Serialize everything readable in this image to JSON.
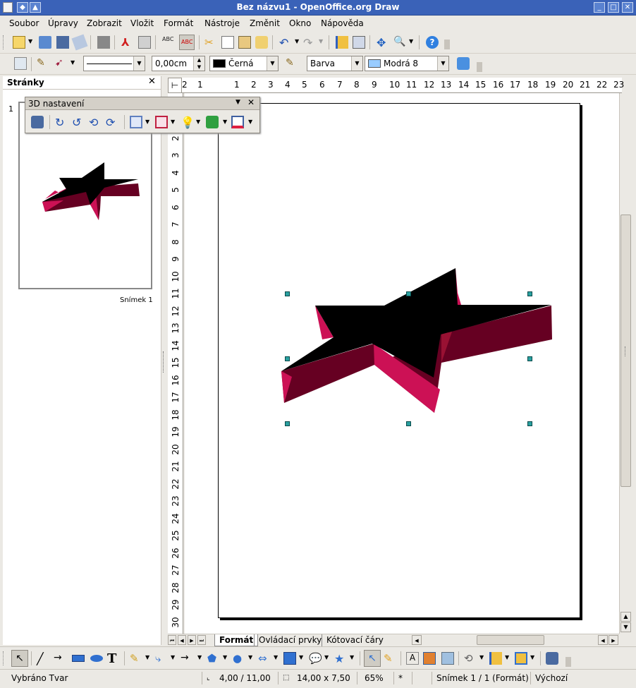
{
  "window": {
    "title": "Bez názvu1 - OpenOffice.org Draw"
  },
  "menu": [
    "Soubor",
    "Úpravy",
    "Zobrazit",
    "Vložit",
    "Formát",
    "Nástroje",
    "Změnit",
    "Okno",
    "Nápověda"
  ],
  "line_toolbar": {
    "line_width": "0,00cm",
    "line_color": "Černá",
    "area_style": "Barva",
    "area_color": "Modrá 8",
    "colors": {
      "line": "#000000",
      "area": "#99ccff"
    }
  },
  "pages_panel": {
    "title": "Stránky",
    "page_number": "1",
    "slide_label": "Snímek 1"
  },
  "float_toolbar": {
    "title": "3D nastavení"
  },
  "ruler_h": [
    "2",
    "1",
    "1",
    "2",
    "3",
    "4",
    "5",
    "6",
    "7",
    "8",
    "9",
    "10",
    "11",
    "12",
    "13",
    "14",
    "15",
    "16",
    "17",
    "18",
    "19",
    "20",
    "21",
    "22",
    "23"
  ],
  "ruler_v": [
    "1",
    "2",
    "3",
    "4",
    "5",
    "6",
    "7",
    "8",
    "9",
    "10",
    "11",
    "12",
    "13",
    "14",
    "15",
    "16",
    "17",
    "18",
    "19",
    "20",
    "21",
    "22",
    "23",
    "24",
    "25",
    "26",
    "27",
    "28",
    "29",
    "30"
  ],
  "tabs": [
    "Formát",
    "Ovládací prvky",
    "Kótovací čáry"
  ],
  "status": {
    "selection": "Vybráno Tvar",
    "position": "4,00 / 11,00",
    "size": "14,00 x 7,50",
    "zoom": "65%",
    "modified": "*",
    "slide": "Snímek 1 / 1 (Formát)",
    "layout": "Výchozí"
  },
  "shape_colors": {
    "top": "#000000",
    "side_light": "#cc1155",
    "side_dark": "#660022",
    "side_mid": "#991133"
  }
}
